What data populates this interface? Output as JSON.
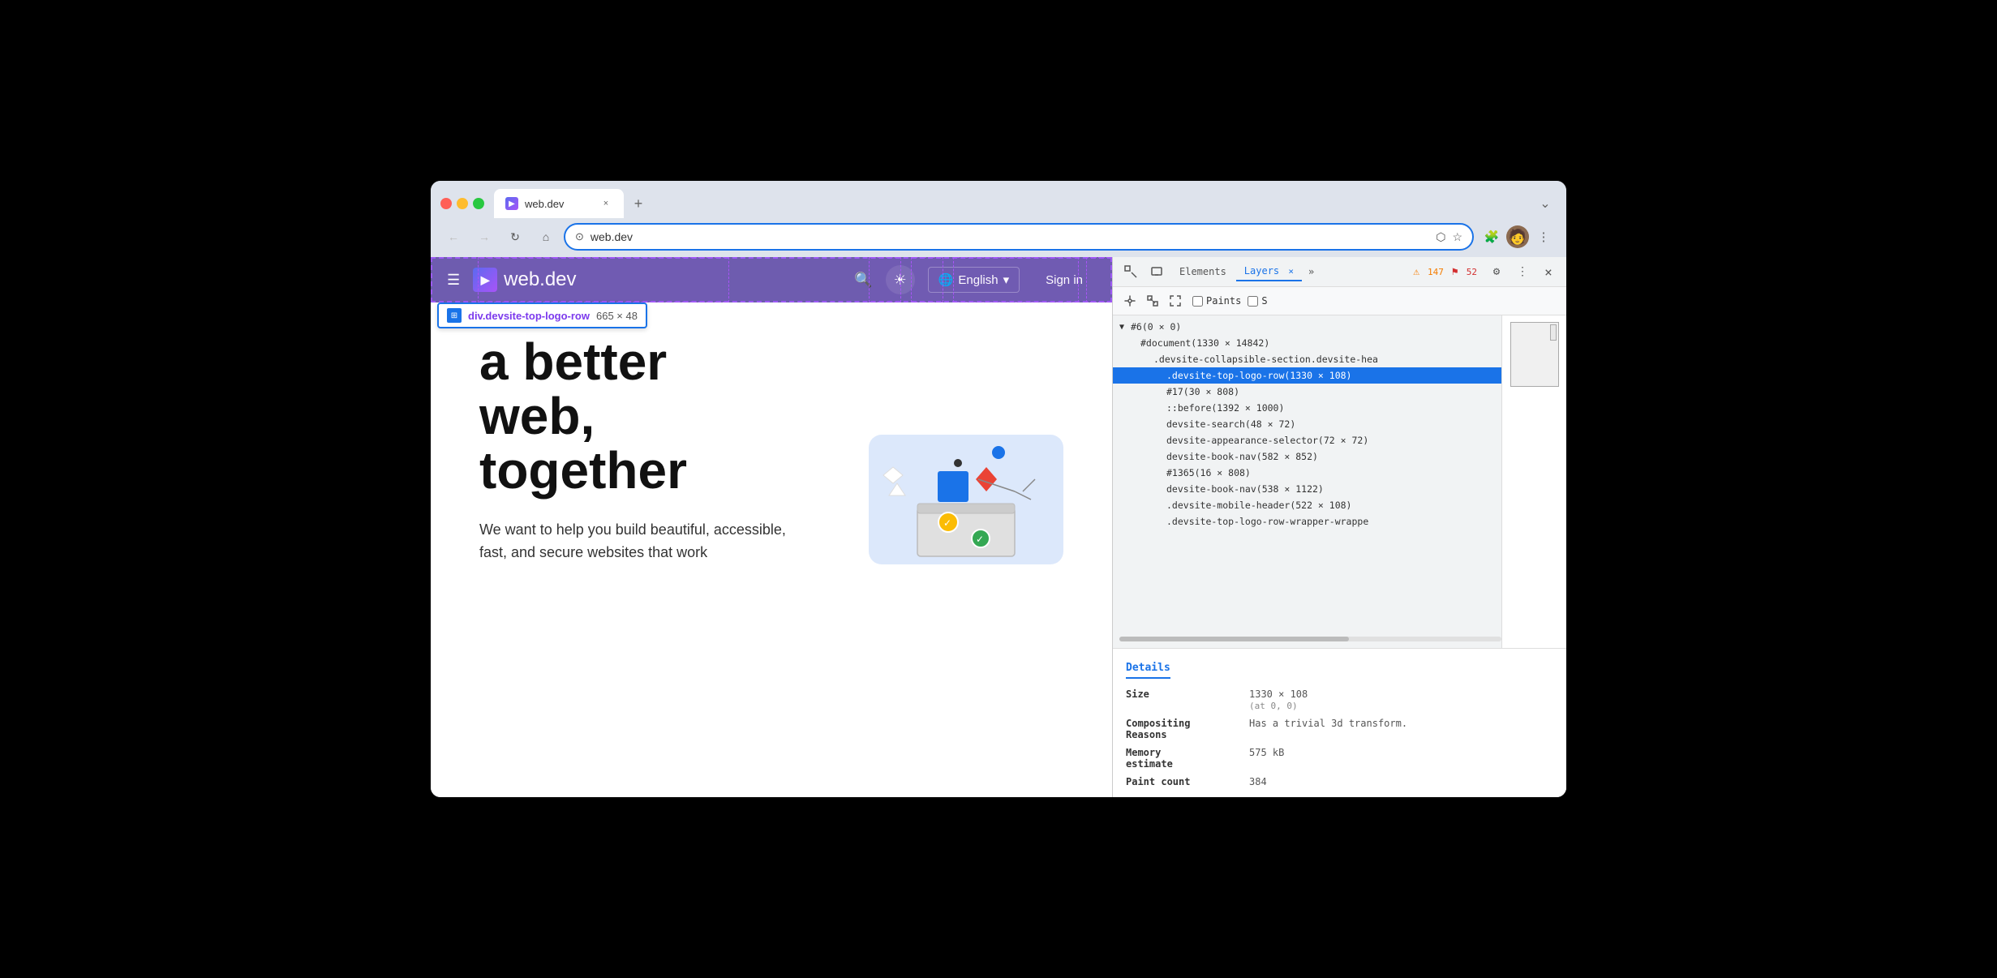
{
  "browser": {
    "tab_title": "web.dev",
    "tab_favicon": "▶",
    "tab_close": "×",
    "tab_new": "+",
    "tab_dropdown": "⌄",
    "nav_back": "←",
    "nav_forward": "→",
    "nav_refresh": "↻",
    "nav_home": "⌂",
    "address_icon": "⊙",
    "address_url": "web.dev",
    "address_external": "⬡",
    "address_star": "☆",
    "nav_extensions": "🧩",
    "nav_menu": "⋮"
  },
  "webpage": {
    "header": {
      "hamburger": "☰",
      "logo_icon": "▶",
      "logo_text": "web.dev",
      "search_icon": "🔍",
      "theme_icon": "☀",
      "lang_icon": "🌐",
      "lang_text": "English",
      "lang_arrow": "▾",
      "signin": "Sign in"
    },
    "inspector_tooltip": {
      "selector": "div.devsite-top-logo-row",
      "size": "665 × 48"
    },
    "headline_line1": "a better",
    "headline_line2": "web,",
    "headline_line3": "together",
    "description": "We want to help you build beautiful, accessible, fast, and secure websites that work"
  },
  "devtools": {
    "toolbar": {
      "inspect_icon": "⊹",
      "device_icon": "⬜",
      "tab_elements": "Elements",
      "tab_layers": "Layers",
      "tab_layers_close": "×",
      "tab_more": "»",
      "warning_count": "147",
      "error_count": "52",
      "settings_icon": "⚙",
      "more_icon": "⋮",
      "close_icon": "×"
    },
    "layers_toolbar": {
      "pan_icon": "✋",
      "rotate_icon": "↻",
      "scale_icon": "⤢",
      "paints_label": "Paints",
      "slow_scroll_label": "S"
    },
    "tree": {
      "items": [
        {
          "text": "#6(0 × 0)",
          "indent": 0,
          "arrow": "▼",
          "selected": false
        },
        {
          "text": "#document(1330 × 14842)",
          "indent": 1,
          "arrow": "",
          "selected": false
        },
        {
          "text": ".devsite-collapsible-section.devsite-hea",
          "indent": 2,
          "arrow": "",
          "selected": false
        },
        {
          "text": ".devsite-top-logo-row(1330 × 108)",
          "indent": 3,
          "arrow": "",
          "selected": true
        },
        {
          "text": "#17(30 × 808)",
          "indent": 3,
          "arrow": "",
          "selected": false
        },
        {
          "text": "::before(1392 × 1000)",
          "indent": 3,
          "arrow": "",
          "selected": false
        },
        {
          "text": "devsite-search(48 × 72)",
          "indent": 3,
          "arrow": "",
          "selected": false
        },
        {
          "text": "devsite-appearance-selector(72 × 72)",
          "indent": 3,
          "arrow": "",
          "selected": false
        },
        {
          "text": "devsite-book-nav(582 × 852)",
          "indent": 3,
          "arrow": "",
          "selected": false
        },
        {
          "text": "#1365(16 × 808)",
          "indent": 3,
          "arrow": "",
          "selected": false
        },
        {
          "text": "devsite-book-nav(538 × 1122)",
          "indent": 3,
          "arrow": "",
          "selected": false
        },
        {
          "text": ".devsite-mobile-header(522 × 108)",
          "indent": 3,
          "arrow": "",
          "selected": false
        },
        {
          "text": ".devsite-top-logo-row-wrapper-wrappe",
          "indent": 3,
          "arrow": "",
          "selected": false
        }
      ]
    },
    "details": {
      "title": "Details",
      "size_label": "Size",
      "size_value": "1330 × 108",
      "size_sub": "(at 0, 0)",
      "compositing_label": "Compositing\nReasons",
      "compositing_value": "Has a trivial 3d transform.",
      "memory_label": "Memory\nestimate",
      "memory_value": "575 kB",
      "paint_label": "Paint count",
      "paint_value": "384"
    }
  }
}
